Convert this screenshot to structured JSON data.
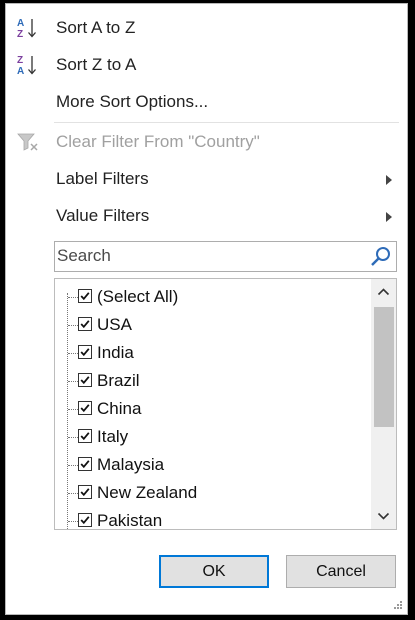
{
  "menu": {
    "sort_az": "Sort A to Z",
    "sort_za": "Sort Z to A",
    "more_sort": "More Sort Options...",
    "clear_filter": "Clear Filter From \"Country\"",
    "label_filters": "Label Filters",
    "value_filters": "Value Filters"
  },
  "search": {
    "placeholder": "Search"
  },
  "list": {
    "items": [
      {
        "label": "(Select All)",
        "checked": true
      },
      {
        "label": "USA",
        "checked": true
      },
      {
        "label": "India",
        "checked": true
      },
      {
        "label": "Brazil",
        "checked": true
      },
      {
        "label": "China",
        "checked": true
      },
      {
        "label": "Italy",
        "checked": true
      },
      {
        "label": "Malaysia",
        "checked": true
      },
      {
        "label": "New Zealand",
        "checked": true
      },
      {
        "label": "Pakistan",
        "checked": true
      }
    ]
  },
  "buttons": {
    "ok": "OK",
    "cancel": "Cancel"
  },
  "icons": {
    "sort_az": "sort-ascending-icon",
    "sort_za": "sort-descending-icon",
    "clear_filter": "clear-filter-icon",
    "search": "search-icon"
  },
  "colors": {
    "accent": "#0078d7",
    "az_blue": "#2e6bb8",
    "az_purple": "#7b3f9e"
  }
}
